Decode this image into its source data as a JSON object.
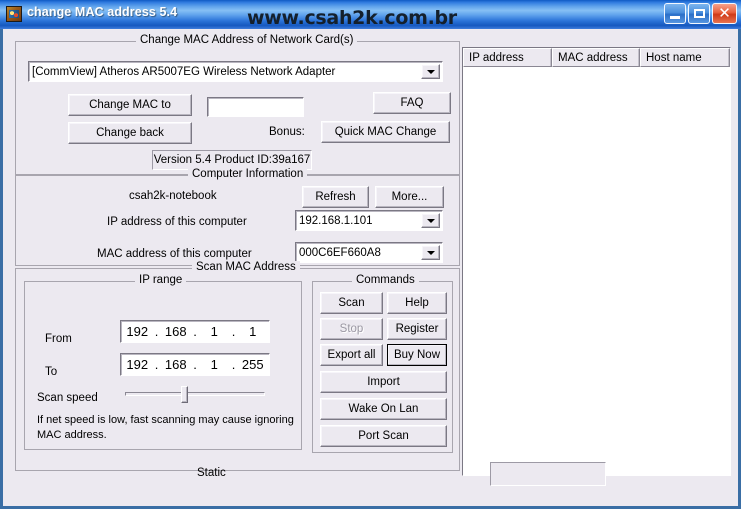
{
  "window": {
    "title": "change MAC address 5.4",
    "icon": "app-icon",
    "watermark": "www.csah2k.com.br",
    "caption_buttons": [
      {
        "name": "minimize",
        "glyph": "minimize-icon"
      },
      {
        "name": "maximize",
        "glyph": "maximize-icon"
      },
      {
        "name": "close",
        "glyph": "close-icon",
        "label": "✕"
      }
    ]
  },
  "change_mac_group": {
    "title": "Change MAC  Address of Network Card(s)",
    "adapter_combo": {
      "value": "[CommView] Atheros AR5007EG Wireless Network Adapter"
    },
    "change_mac_to_button": "Change MAC to",
    "change_back_button": "Change back",
    "mac_input_value": "",
    "bonus_label": "Bonus:",
    "faq_button": "FAQ",
    "quick_mac_change_button": "Quick MAC Change",
    "version_text": "Version 5.4  Product ID:39a167"
  },
  "computer_info_group": {
    "title": "Computer Information",
    "computer_name": "csah2k-notebook",
    "refresh_button": "Refresh",
    "more_button": "More...",
    "ip_label": "IP address of this computer",
    "ip_value": "192.168.1.101",
    "mac_label": "MAC address of this computer",
    "mac_value": "000C6EF660A8"
  },
  "scan_group": {
    "title": "Scan MAC Address",
    "ip_range": {
      "title": "IP range",
      "from_label": "From",
      "from_octets": [
        "192",
        "168",
        "1",
        "1"
      ],
      "to_label": "To",
      "to_octets": [
        "192",
        "168",
        "1",
        "255"
      ],
      "separator": "."
    },
    "scan_speed_label": "Scan speed",
    "scan_speed_percent": 42,
    "hint_line1": "If net speed is low,  fast scanning may cause ignoring",
    "hint_line2": "MAC address."
  },
  "commands_group": {
    "title": "Commands",
    "buttons": [
      {
        "label": "Scan",
        "disabled": false,
        "default": false
      },
      {
        "label": "Help",
        "disabled": false,
        "default": false
      },
      {
        "label": "Stop",
        "disabled": true,
        "default": false
      },
      {
        "label": "Register",
        "disabled": false,
        "default": false
      },
      {
        "label": "Export all",
        "disabled": false,
        "default": false
      },
      {
        "label": "Buy Now",
        "disabled": false,
        "default": true
      },
      {
        "label": "Import",
        "disabled": false,
        "default": false
      },
      {
        "label": "Wake On Lan",
        "disabled": false,
        "default": false
      },
      {
        "label": "Port Scan",
        "disabled": false,
        "default": false
      }
    ]
  },
  "results_list": {
    "columns": [
      "IP address",
      "MAC address",
      "Host name"
    ],
    "rows": []
  },
  "status_bar": {
    "text": "Static",
    "progress_value": ""
  },
  "colors": {
    "window_face": "#ece9f0",
    "title_blue": "#2f7adf",
    "frame_border": "#3a6ea5",
    "field_white": "#ffffff"
  }
}
